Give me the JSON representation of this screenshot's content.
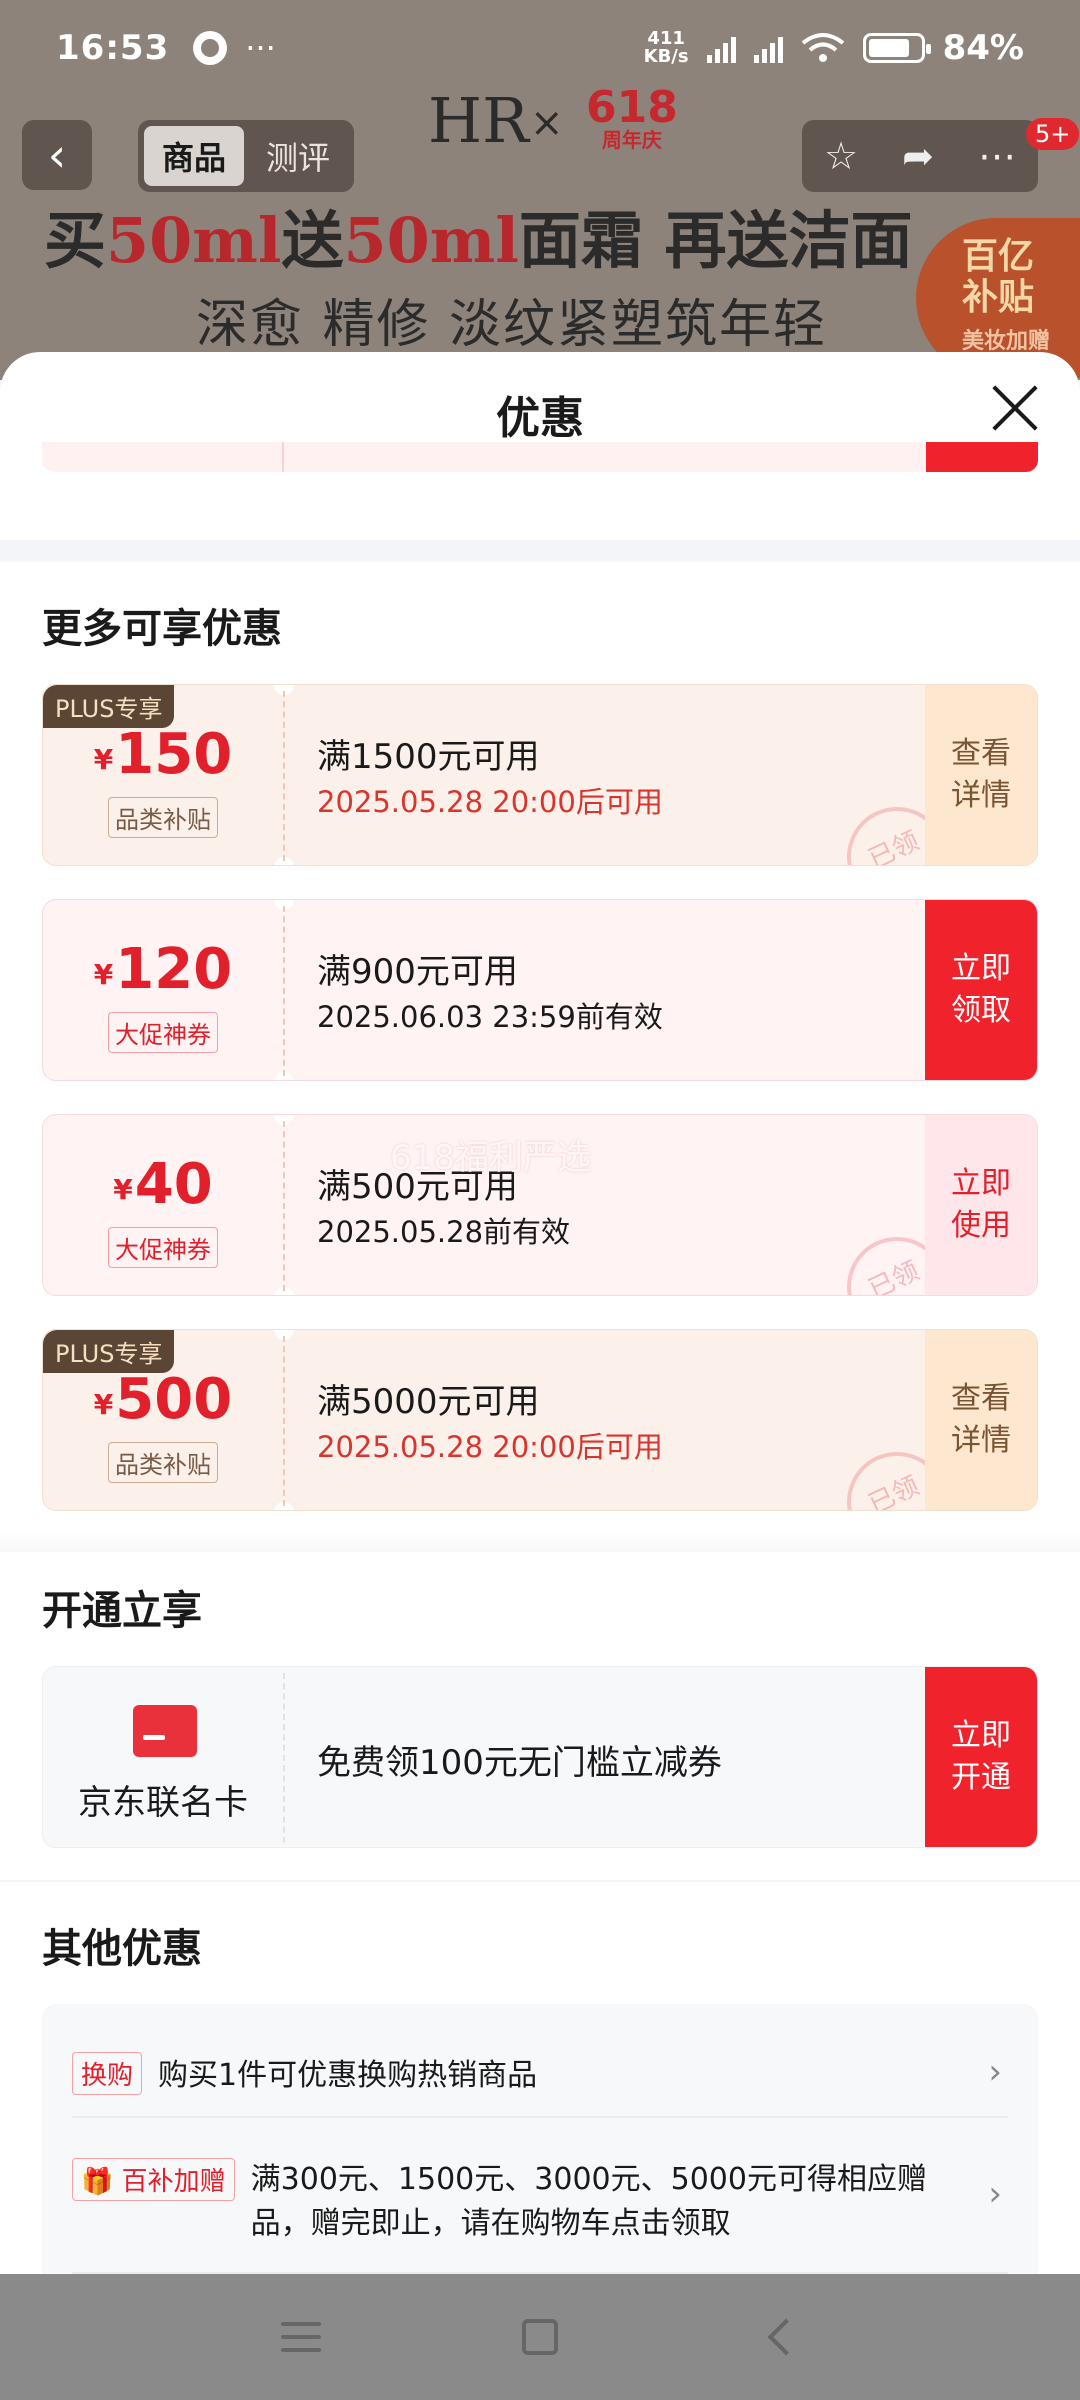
{
  "status_bar": {
    "time": "16:53",
    "more": "···",
    "speed_top": "411",
    "speed_bottom": "KB/s",
    "battery": "84%"
  },
  "product_header": {
    "back_glyph": "‹",
    "tabs": [
      {
        "label": "商品",
        "active": true
      },
      {
        "label": "测评",
        "active": false
      }
    ],
    "brand": "HR",
    "brand_cross": "×",
    "brand_618_number": "618",
    "brand_618_caption": "周年庆",
    "action_icons": [
      "star-icon",
      "share-icon",
      "more-icon"
    ],
    "badge": "5+",
    "banner_line1_parts": [
      "买",
      "50ml",
      "送",
      "50ml",
      "面霜 再送洁面"
    ],
    "banner_line2": "深愈 精修 淡纹紧塑筑年轻",
    "sticker_line1": "百亿",
    "sticker_line2": "补贴",
    "sticker_small": "美妆加赠"
  },
  "sheet": {
    "title": "优惠",
    "section_more": "更多可享优惠",
    "coupons": [
      {
        "plus": "PLUS专享",
        "currency": "¥",
        "amount": "150",
        "tag": "品类补贴",
        "condition": "满1500元可用",
        "date": "2025.05.28 20:00后可用",
        "action": "查看\n详情",
        "stamp": "已领",
        "style": "beige"
      },
      {
        "plus": "",
        "currency": "¥",
        "amount": "120",
        "tag": "大促神券",
        "condition": "满900元可用",
        "date": "2025.06.03 23:59前有效",
        "action": "立即\n领取",
        "stamp": "",
        "style": "pink"
      },
      {
        "plus": "",
        "currency": "¥",
        "amount": "40",
        "tag": "大促神券",
        "condition": "满500元可用",
        "date": "2025.05.28前有效",
        "action": "立即\n使用",
        "stamp": "已领",
        "style": "pink"
      },
      {
        "plus": "PLUS专享",
        "currency": "¥",
        "amount": "500",
        "tag": "品类补贴",
        "condition": "满5000元可用",
        "date": "2025.05.28 20:00后可用",
        "action": "查看\n详情",
        "stamp": "已领",
        "style": "beige"
      }
    ],
    "watermark": "618福利严选",
    "section_open": "开通立享",
    "jd_card": {
      "name": "京东联名卡",
      "desc": "免费领100元无门槛立减券",
      "action": "立即\n开通"
    },
    "section_other": "其他优惠",
    "other_items": [
      {
        "tag": "换购",
        "text": "购买1件可优惠换购热销商品"
      },
      {
        "tag": "百补加赠",
        "text": "满300元、1500元、3000元、5000元可得相应赠品，赠完即止，请在购物车点击领取"
      }
    ]
  },
  "colors": {
    "accent_red": "#f0222b",
    "price_red": "#e2202b",
    "plus_brown": "#5b4636"
  }
}
